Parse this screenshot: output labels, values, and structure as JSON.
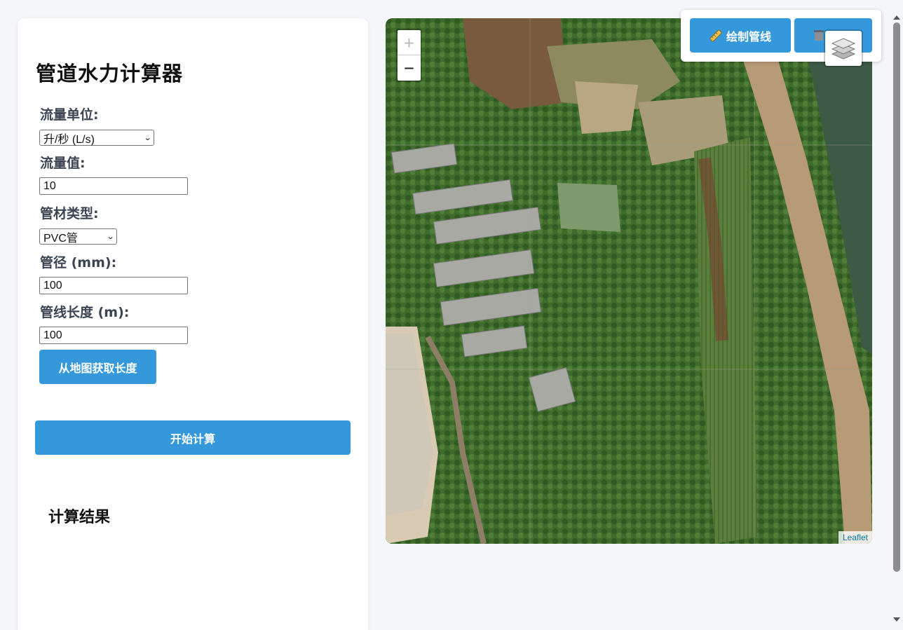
{
  "calculator": {
    "title": "管道水力计算器",
    "flow_unit_label": "流量单位:",
    "flow_unit_value": "升/秒 (L/s)",
    "flow_value_label": "流量值:",
    "flow_value": "10",
    "pipe_material_label": "管材类型:",
    "pipe_material_value": "PVC管",
    "diameter_label": "管径 (mm):",
    "diameter_value": "100",
    "length_label": "管线长度 (m):",
    "length_value": "100",
    "get_length_button": "从地图获取长度",
    "calculate_button": "开始计算",
    "results_title": "计算结果"
  },
  "map": {
    "zoom_in": "+",
    "zoom_out": "−",
    "attribution": "Leaflet",
    "draw_button": "绘制管线",
    "draw_icon": "ruler-icon",
    "clear_icon": "trash-icon",
    "layers_icon": "layers-icon"
  },
  "colors": {
    "accent": "#3498db",
    "background": "#f4f6fa"
  }
}
